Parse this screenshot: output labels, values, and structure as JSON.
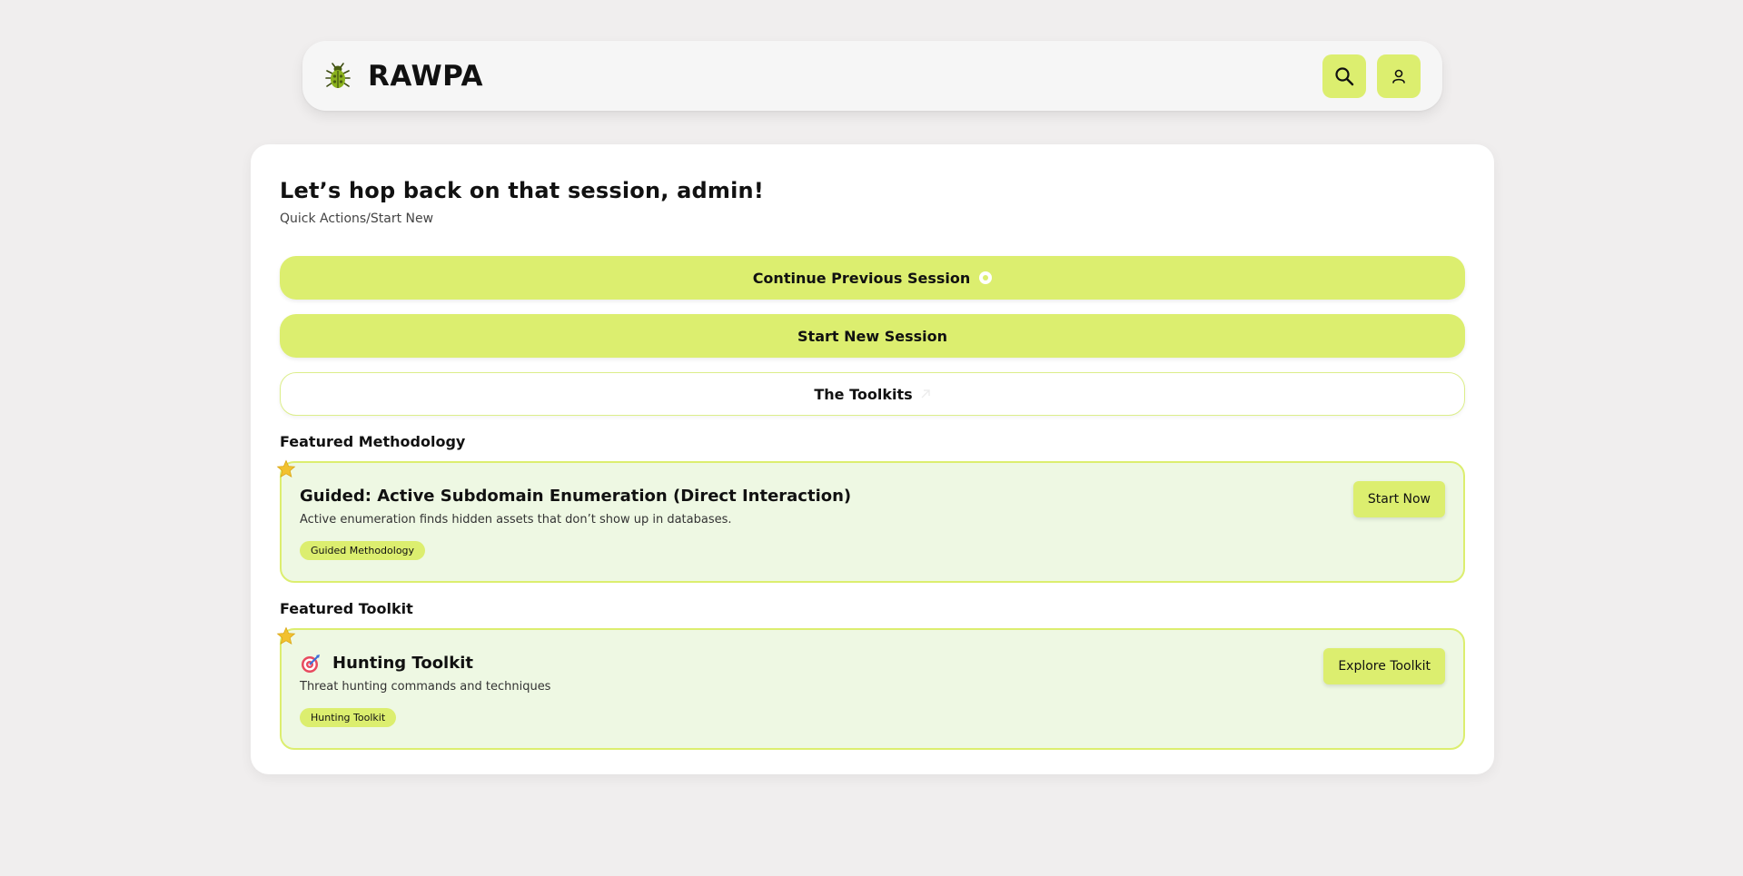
{
  "header": {
    "brand": "RAWPA",
    "logo_icon": "beetle-icon",
    "search_icon": "search-icon",
    "profile_icon": "user-icon"
  },
  "main": {
    "greeting": "Let’s hop back on that session, admin!",
    "subtitle": "Quick Actions/Start New",
    "actions": [
      {
        "label": "Continue Previous Session",
        "icon": "circle-dot-icon"
      },
      {
        "label": "Start New Session"
      },
      {
        "label": "The Toolkits",
        "icon": "faint-icon"
      }
    ],
    "featured_methodology": {
      "section_label": "Featured Methodology",
      "title": "Guided: Active Subdomain Enumeration (Direct Interaction)",
      "description": "Active enumeration finds hidden assets that don’t show up in databases.",
      "tag": "Guided Methodology",
      "button": "Start Now",
      "badge_icon": "star-icon"
    },
    "featured_toolkit": {
      "section_label": "Featured Toolkit",
      "title": "Hunting Toolkit",
      "title_icon": "target-icon",
      "description": "Threat hunting commands and techniques",
      "tag": "Hunting Toolkit",
      "button": "Explore Toolkit",
      "badge_icon": "star-icon"
    }
  },
  "colors": {
    "accent": "#dcee6f",
    "feature_bg": "#eef8e3",
    "page_bg": "#f0eeee",
    "star": "#f2c12e"
  }
}
